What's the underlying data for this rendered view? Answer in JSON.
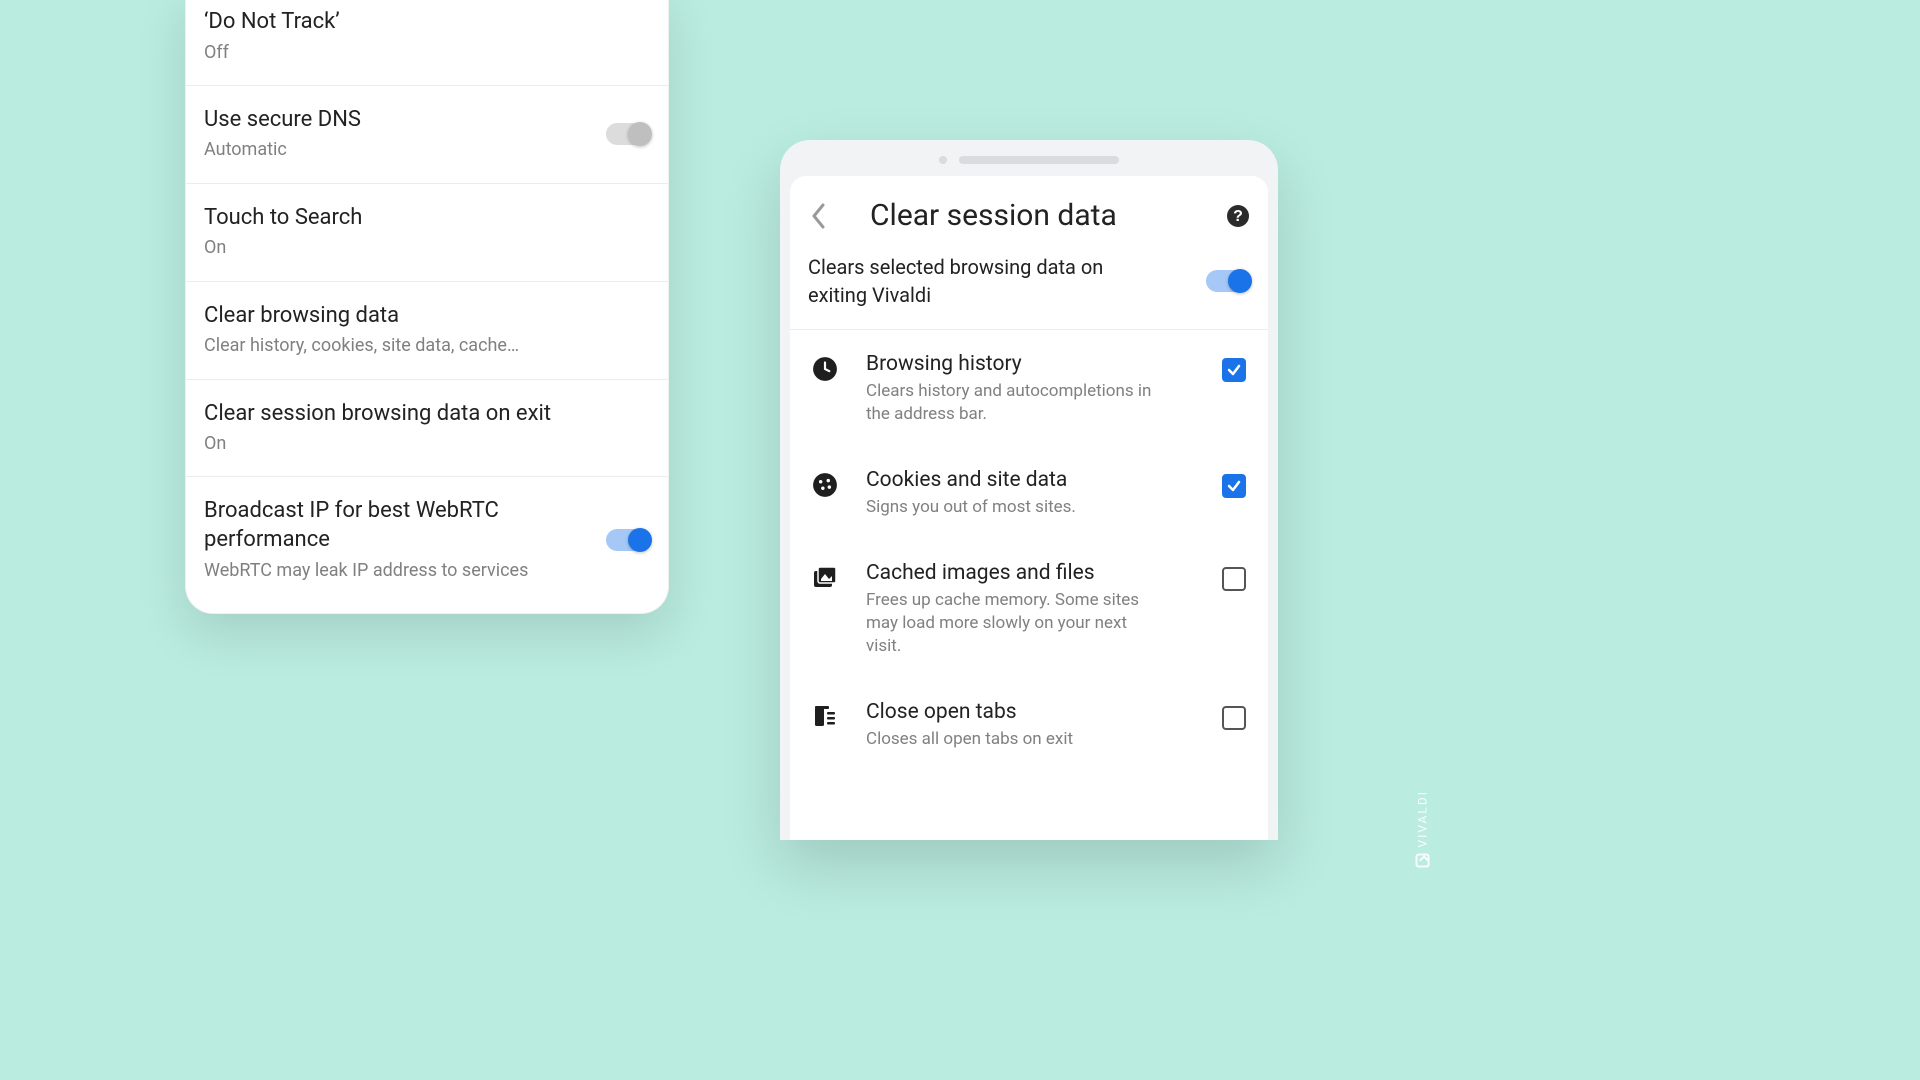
{
  "left": {
    "items": [
      {
        "title": "‘Do Not Track’",
        "sub": "Off",
        "toggle": null
      },
      {
        "title": "Use secure DNS",
        "sub": "Automatic",
        "toggle": "off"
      },
      {
        "title": "Touch to Search",
        "sub": "On",
        "toggle": null
      },
      {
        "title": "Clear browsing data",
        "sub": "Clear history, cookies, site data, cache…",
        "toggle": null
      },
      {
        "title": "Clear session browsing data on exit",
        "sub": "On",
        "toggle": null
      },
      {
        "title": "Broadcast IP for best WebRTC performance",
        "sub": "WebRTC may leak IP address to services",
        "toggle": "on"
      }
    ]
  },
  "right": {
    "title": "Clear session data",
    "master": {
      "text": "Clears selected browsing data on exiting Vivaldi",
      "enabled": true
    },
    "options": [
      {
        "icon": "clock",
        "title": "Browsing history",
        "sub": "Clears history and autocompletions in the address bar.",
        "checked": true
      },
      {
        "icon": "cookie",
        "title": "Cookies and site data",
        "sub": "Signs you out of most sites.",
        "checked": true
      },
      {
        "icon": "image",
        "title": "Cached images and files",
        "sub": "Frees up cache memory. Some sites may load more slowly on your next visit.",
        "checked": false
      },
      {
        "icon": "tabs",
        "title": "Close open tabs",
        "sub": "Closes all open tabs on exit",
        "checked": false
      }
    ]
  },
  "watermark": "VIVALDI"
}
